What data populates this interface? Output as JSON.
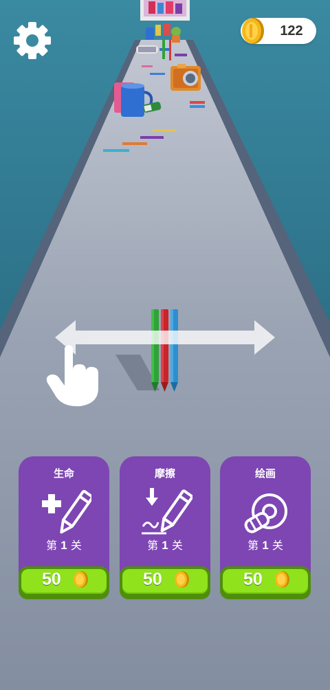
{
  "hud": {
    "coins": "122",
    "settings_icon": "gear-icon",
    "coin_icon": "coin-icon"
  },
  "tutorial": {
    "hint": "swipe-left-right",
    "hand_icon": "pointing-hand-icon",
    "arrow_icon": "double-arrow-icon"
  },
  "player": {
    "crayon_colors": [
      "#2fa238",
      "#c9242a",
      "#2d8fd0"
    ]
  },
  "colors": {
    "background": "#3e8ea4",
    "track": "#8a96a8",
    "card": "#7d46b3",
    "button_green": "#8fe21c"
  },
  "upgrades": [
    {
      "title": "生命",
      "icon": "plus-pencil-icon",
      "level_prefix": "第",
      "level_number": "1",
      "level_suffix": "关",
      "price": "50"
    },
    {
      "title": "摩擦",
      "icon": "friction-pencil-icon",
      "level_prefix": "第",
      "level_number": "1",
      "level_suffix": "关",
      "price": "50"
    },
    {
      "title": "绘画",
      "icon": "tape-roll-icon",
      "level_prefix": "第",
      "level_number": "1",
      "level_suffix": "关",
      "price": "50"
    }
  ]
}
